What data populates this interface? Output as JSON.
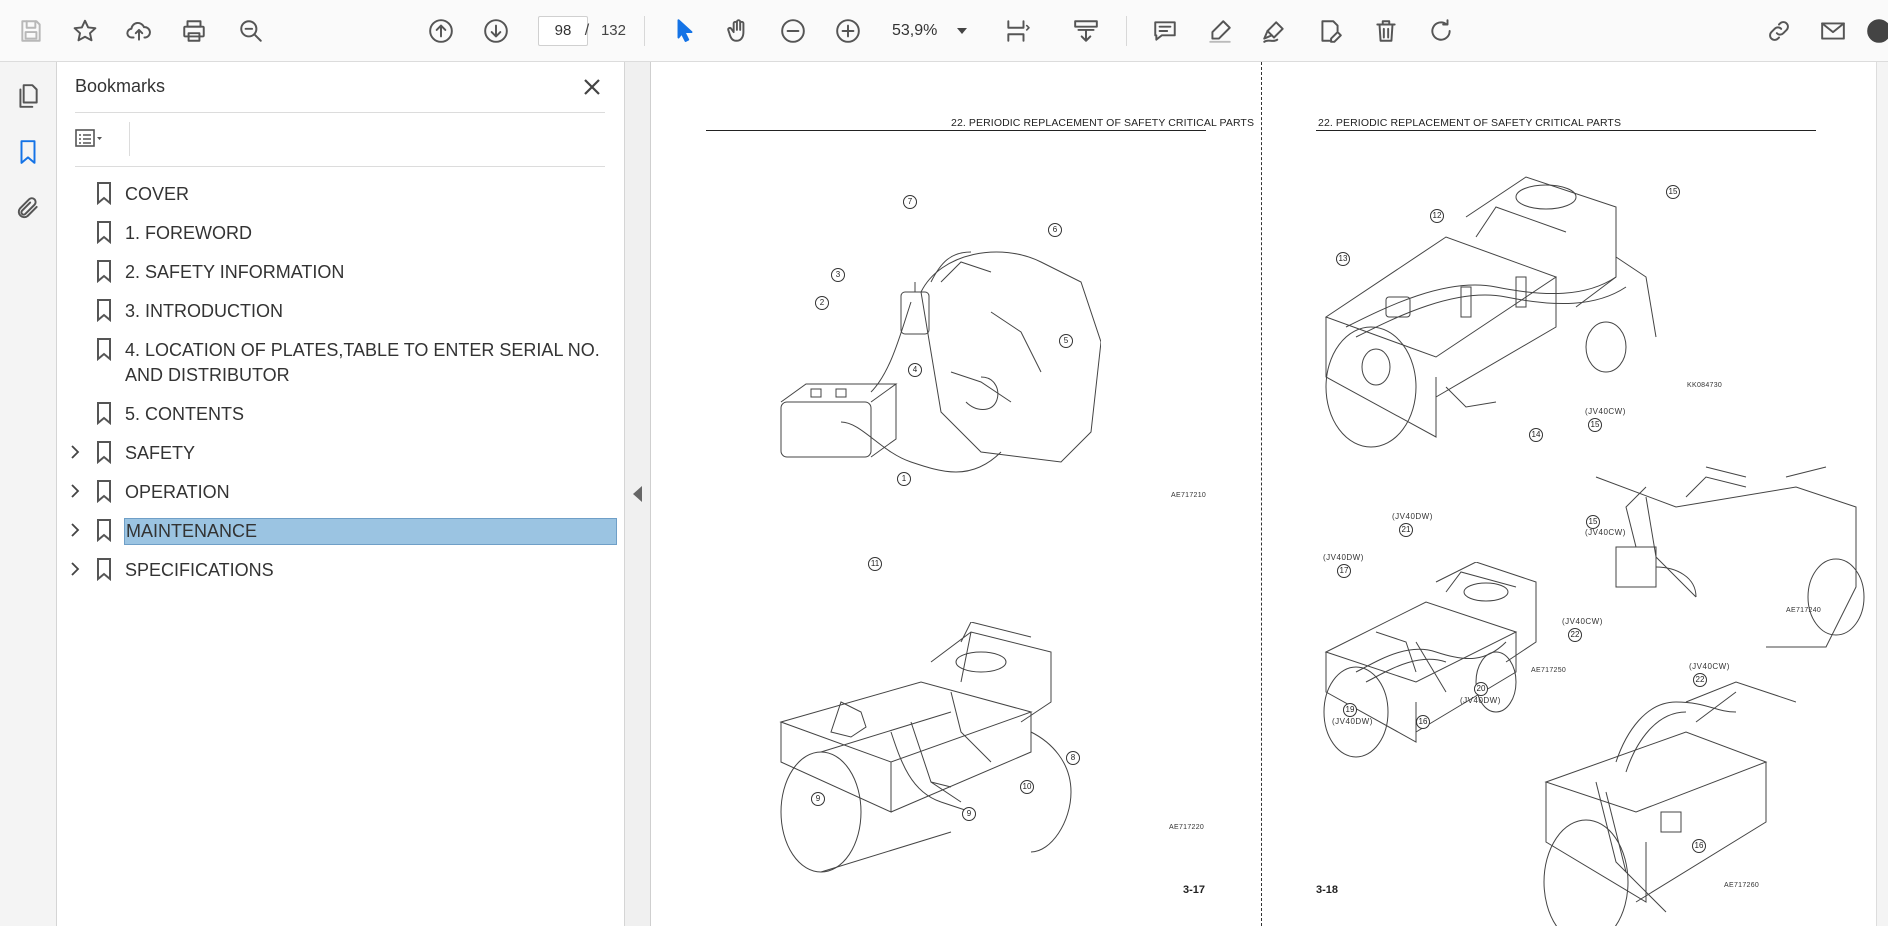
{
  "toolbar": {
    "page_current": "98",
    "page_separator": "/",
    "page_total": "132",
    "zoom": "53,9%"
  },
  "bookmarks": {
    "title": "Bookmarks",
    "items": [
      {
        "label": "COVER",
        "expandable": false
      },
      {
        "label": "1. FOREWORD",
        "expandable": false
      },
      {
        "label": "2. SAFETY INFORMATION",
        "expandable": false
      },
      {
        "label": "3. INTRODUCTION",
        "expandable": false
      },
      {
        "label": "4. LOCATION OF PLATES,TABLE TO ENTER SERIAL NO. AND DISTRIBUTOR",
        "expandable": false
      },
      {
        "label": "5. CONTENTS",
        "expandable": false
      },
      {
        "label": "SAFETY",
        "expandable": true
      },
      {
        "label": "OPERATION",
        "expandable": true
      },
      {
        "label": "MAINTENANCE",
        "expandable": true,
        "selected": true
      },
      {
        "label": "SPECIFICATIONS",
        "expandable": true
      }
    ]
  },
  "document": {
    "left_page": {
      "header": "22. PERIODIC REPLACEMENT OF SAFETY CRITICAL PARTS",
      "fig1_code": "AE717210",
      "fig2_code": "AE717220",
      "page_number": "3-17"
    },
    "right_page": {
      "header": "22. PERIODIC REPLACEMENT OF SAFETY CRITICAL PARTS",
      "fig1_code": "KK084730",
      "fig2_code": "AE717240",
      "fig3_code": "AE717250",
      "fig4_code": "AE717260",
      "page_number": "3-18",
      "model_cw": "(JV40CW)",
      "model_dw": "(JV40DW)"
    },
    "callouts": {
      "c1": "1",
      "c2": "2",
      "c3": "3",
      "c4": "4",
      "c5": "5",
      "c6": "6",
      "c7": "7",
      "c8": "8",
      "c9": "9",
      "c10": "10",
      "c11": "11",
      "c12": "12",
      "c13": "13",
      "c14": "14",
      "c15": "15",
      "c16": "16",
      "c17": "17",
      "c18": "18",
      "c19": "19",
      "c20": "20",
      "c21": "21",
      "c22": "22"
    }
  },
  "colors": {
    "accent": "#1473e6",
    "selection": "#9bc4e2"
  }
}
